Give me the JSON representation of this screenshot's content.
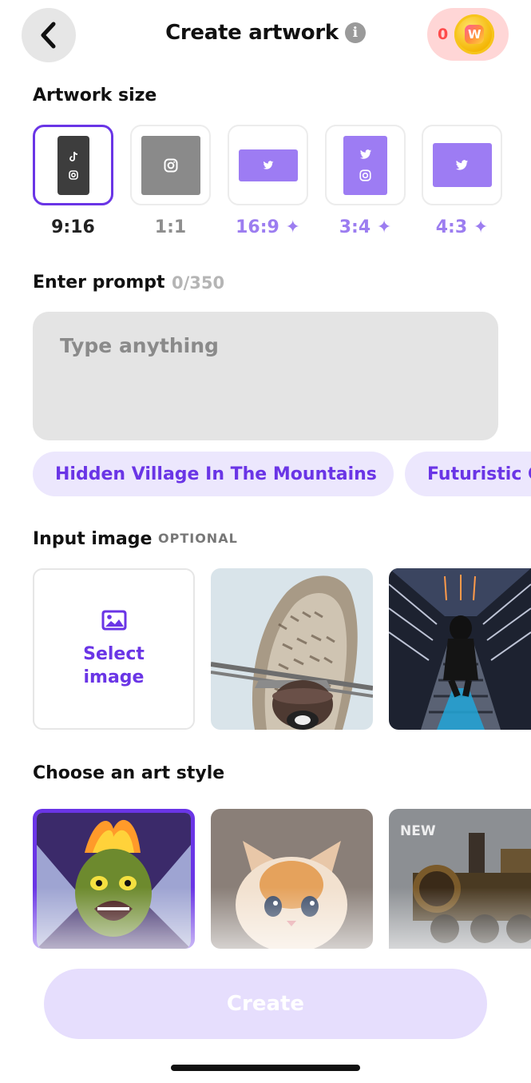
{
  "header": {
    "title": "Create artwork",
    "info_icon": "info-icon",
    "back_icon": "chevron-left-icon",
    "coin_count": "0",
    "coin_symbol": "W"
  },
  "artwork_size": {
    "label": "Artwork size",
    "options": [
      {
        "label": "9:16",
        "selected": true,
        "premium": false,
        "icons": [
          "tiktok-icon",
          "instagram-icon"
        ]
      },
      {
        "label": "1:1",
        "selected": false,
        "premium": false,
        "icons": [
          "instagram-icon"
        ]
      },
      {
        "label": "16:9",
        "selected": false,
        "premium": true,
        "icons": [
          "twitter-icon"
        ]
      },
      {
        "label": "3:4",
        "selected": false,
        "premium": true,
        "icons": [
          "twitter-icon",
          "instagram-icon"
        ]
      },
      {
        "label": "4:3",
        "selected": false,
        "premium": true,
        "icons": [
          "twitter-icon"
        ]
      }
    ],
    "sparkle": "✦"
  },
  "prompt": {
    "label": "Enter prompt",
    "counter": "0/350",
    "placeholder": "Type anything",
    "value": ""
  },
  "suggestions": [
    "Hidden Village In The Mountains",
    "Futuristic C"
  ],
  "input_image": {
    "label": "Input image",
    "optional_tag": "OPTIONAL",
    "select_line1": "Select",
    "select_line2": "image",
    "samples": [
      "owl-on-wire-photo",
      "escalator-tunnel-photo"
    ]
  },
  "art_style": {
    "label": "Choose an art style",
    "styles": [
      "goblin-flames-style",
      "kitten-style",
      "steam-train-style"
    ],
    "new_badge": "NEW"
  },
  "create_button": "Create",
  "colors": {
    "accent": "#6a35e6",
    "accent_light": "#ece7fd",
    "premium": "#9c7df0",
    "coin_pill": "#ffd6d6"
  }
}
